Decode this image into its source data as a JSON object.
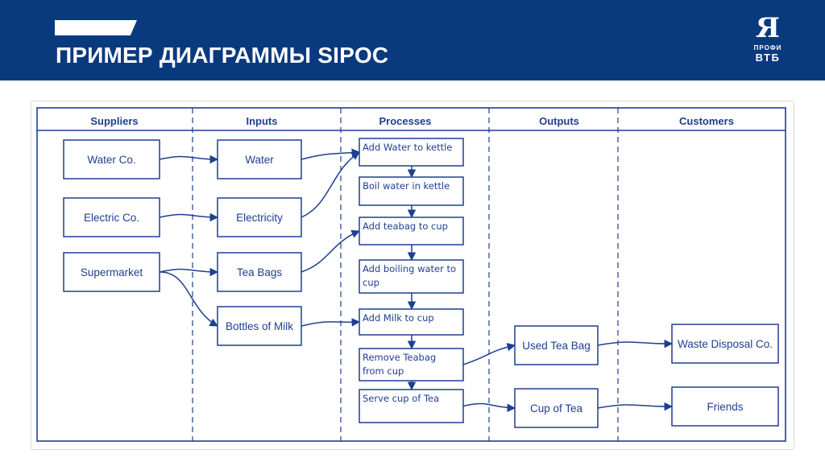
{
  "banner": {
    "title": "ПРИМЕР ДИАГРАММЫ SIPOC",
    "background_color": "#0a3a7e",
    "logo": {
      "mark": "Я",
      "line1": "ПРОФИ",
      "line2": "ВТБ"
    }
  },
  "diagram": {
    "line_color": "#1f3f8f",
    "columns": [
      {
        "id": "suppliers",
        "label": "Suppliers"
      },
      {
        "id": "inputs",
        "label": "Inputs"
      },
      {
        "id": "processes",
        "label": "Processes"
      },
      {
        "id": "outputs",
        "label": "Outputs"
      },
      {
        "id": "customers",
        "label": "Customers"
      }
    ],
    "suppliers": [
      "Water Co.",
      "Electric Co.",
      "Supermarket"
    ],
    "inputs": [
      "Water",
      "Electricity",
      "Tea Bags",
      "Bottles of Milk"
    ],
    "processes": [
      [
        "Add Water to kettle"
      ],
      [
        "Boil water in kettle"
      ],
      [
        "Add teabag to cup"
      ],
      [
        "Add boiling water to",
        "cup"
      ],
      [
        "Add Milk to cup"
      ],
      [
        "Remove Teabag",
        "from cup"
      ],
      [
        "Serve cup of Tea"
      ]
    ],
    "outputs": [
      "Used Tea Bag",
      "Cup of Tea"
    ],
    "customers": [
      "Waste Disposal Co.",
      "Friends"
    ],
    "flows": [
      {
        "from": "Water Co.",
        "to": "Water"
      },
      {
        "from": "Electric Co.",
        "to": "Electricity"
      },
      {
        "from": "Supermarket",
        "to": "Tea Bags"
      },
      {
        "from": "Supermarket",
        "to": "Bottles of Milk"
      },
      {
        "from": "Water",
        "to": "Add Water to kettle"
      },
      {
        "from": "Electricity",
        "to": "Add Water to kettle"
      },
      {
        "from": "Tea Bags",
        "to": "Add teabag to cup"
      },
      {
        "from": "Bottles of Milk",
        "to": "Add Milk to cup"
      },
      {
        "from": "Remove Teabag from cup",
        "to": "Used Tea Bag"
      },
      {
        "from": "Serve cup of Tea",
        "to": "Cup of Tea"
      },
      {
        "from": "Used Tea Bag",
        "to": "Waste Disposal Co."
      },
      {
        "from": "Cup of Tea",
        "to": "Friends"
      }
    ]
  }
}
